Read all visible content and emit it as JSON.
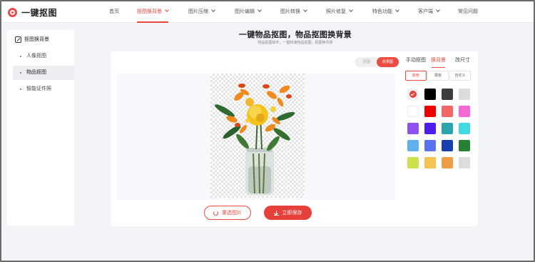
{
  "header": {
    "logo_text": "一键抠图",
    "nav": [
      {
        "label": "首页",
        "name": "nav-home",
        "dropdown": false,
        "active": false
      },
      {
        "label": "抠图换背景",
        "name": "nav-cutout",
        "dropdown": true,
        "active": true
      },
      {
        "label": "图片压缩",
        "name": "nav-compress",
        "dropdown": true,
        "active": false
      },
      {
        "label": "图片编辑",
        "name": "nav-edit",
        "dropdown": true,
        "active": false
      },
      {
        "label": "图片转换",
        "name": "nav-convert",
        "dropdown": true,
        "active": false
      },
      {
        "label": "照片修复",
        "name": "nav-repair",
        "dropdown": true,
        "active": false
      },
      {
        "label": "特色功能",
        "name": "nav-features",
        "dropdown": true,
        "active": false
      },
      {
        "label": "客户端",
        "name": "nav-client",
        "dropdown": true,
        "active": false
      },
      {
        "label": "常见问题",
        "name": "nav-faq",
        "dropdown": false,
        "active": false
      }
    ]
  },
  "sidebar": {
    "title": "抠图换背景",
    "items": [
      {
        "label": "人像抠图",
        "active": false
      },
      {
        "label": "物品抠图",
        "active": true
      },
      {
        "label": "智能证件照",
        "active": false
      }
    ]
  },
  "main": {
    "title": "一键物品抠图，物品抠图换背景",
    "subtitle": "物品抠图软件，一键快速物品抠图，抠图换背景",
    "toggle": {
      "original": "原图",
      "effect": "效果图"
    },
    "reselect_label": "重选图片",
    "save_label": "立即保存"
  },
  "panel": {
    "tabs": [
      {
        "label": "手动抠图",
        "active": false
      },
      {
        "label": "换背景",
        "active": true
      },
      {
        "label": "改尺寸",
        "active": false
      }
    ],
    "subtabs": [
      {
        "label": "颜色",
        "active": true
      },
      {
        "label": "模板",
        "active": false
      },
      {
        "label": "自定义",
        "active": false
      }
    ],
    "more_label": "···",
    "swatches": [
      [
        "transparent-selected",
        "#000000",
        "#3d3d3d",
        "#dcdcdc"
      ],
      [
        "#ffffff",
        "#f20000",
        "#f46565",
        "#f569d4"
      ],
      [
        "#8d52ef",
        "#4f1cf0",
        "#2aa5ad",
        "#41d9e2"
      ],
      [
        "#5fb0ef",
        "#5a72ef",
        "#173fae",
        "#268134"
      ],
      [
        "#cee04b",
        "#f6c352",
        "#ef9d47",
        "more"
      ]
    ]
  }
}
